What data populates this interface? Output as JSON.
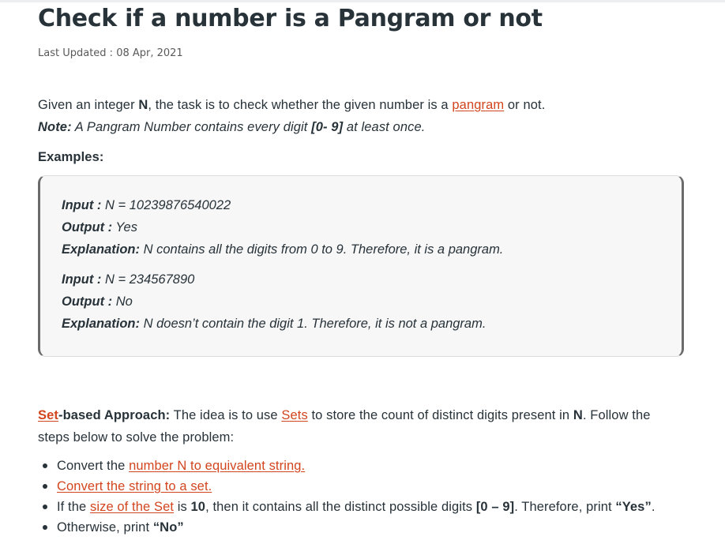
{
  "article": {
    "title": "Check if a number is a Pangram or not",
    "last_updated": "Last Updated : 08 Apr, 2021"
  },
  "intro": {
    "t1": "Given an integer ",
    "n": "N",
    "t2": ", the task is to check whether the given number is a ",
    "link_pangram": "pangram",
    "t3": " or not."
  },
  "note": {
    "label": "Note:",
    "t1": " A Pangram Number contains every digit ",
    "range": "[0- 9]",
    "t2": " at least once."
  },
  "examples_heading": "Examples:",
  "examples": [
    {
      "input_label": "Input :",
      "input_value": " N = 10239876540022",
      "output_label": "Output :",
      "output_value": " Yes",
      "explanation_label": "Explanation:",
      "explanation_value": " N contains all the digits from 0 to 9. Therefore, it is a pangram."
    },
    {
      "input_label": "Input :",
      "input_value": " N = 234567890",
      "output_label": "Output :",
      "output_value": " No",
      "explanation_label": "Explanation:",
      "explanation_value": " N doesn’t contain the digit 1. Therefore, it is not a pangram."
    }
  ],
  "approach": {
    "link_set": "Set",
    "label": "-based Approach:",
    "t1": " The idea is to use ",
    "link_sets": "Sets",
    "t2": " to store the count of distinct digits present in ",
    "n": "N",
    "t3": ". Follow the steps below to solve the problem:"
  },
  "steps": {
    "s1_t1": "Convert the ",
    "s1_link": "number N to equivalent string.",
    "s2_link": "Convert the string to a set.",
    "s3_t1": "If the ",
    "s3_link": "size of the Set",
    "s3_t2": " is ",
    "s3_size": "10",
    "s3_t3": ", then it contains all the distinct possible digits ",
    "s3_range": "[0 – 9]",
    "s3_t4": ". Therefore, print ",
    "s3_yes": "“Yes”",
    "s3_t5": ".",
    "s4_t1": "Otherwise, print ",
    "s4_no": "“No”"
  },
  "colors": {
    "text": "#273239",
    "link": "#d2451e",
    "example_bg": "#f7f7f7",
    "example_border": "#6b6b6b"
  }
}
